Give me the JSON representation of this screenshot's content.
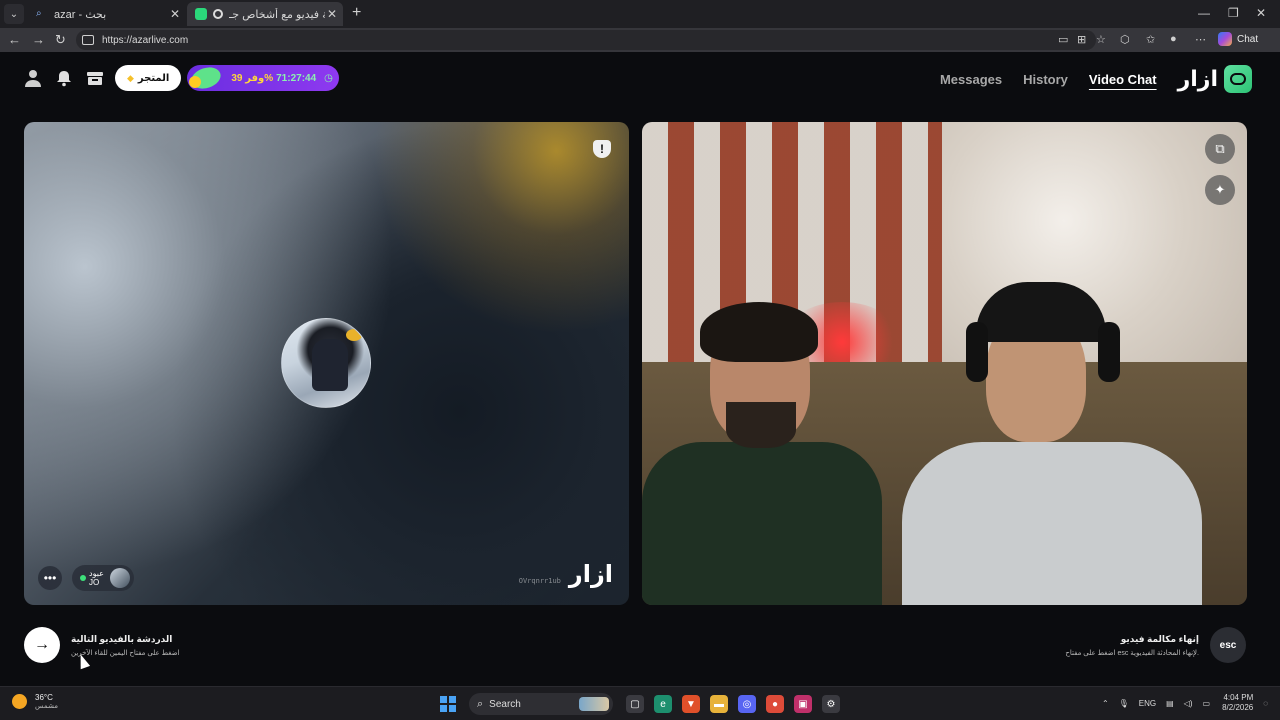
{
  "browser": {
    "tabs": [
      {
        "title": "azar - بحث"
      },
      {
        "title": "أزاردردشة فيديو مع أشخاص جـ"
      }
    ],
    "url": "https://azarlive.com",
    "chat_label": "Chat"
  },
  "header": {
    "store_label": "المتجر",
    "promo_discount": "وفر 39%",
    "promo_timer": "71:27:44",
    "nav": {
      "messages": "Messages",
      "history": "History",
      "video_chat": "Video Chat"
    },
    "brand": "ازار"
  },
  "remote_panel": {
    "peer_name": "عبود",
    "peer_flag": "JO",
    "watermark_code": "OVrqnrr1ub",
    "watermark_logo": "ازار"
  },
  "footer": {
    "next_title": "الدردشة بالفيديو التالية",
    "next_hint": "اضغط على مفتاح اليمين للقاء الآخرين",
    "end_title": "إنهاء مكالمة فيديو",
    "end_hint": "اضغط على مفتاح esc لإنهاء المحادثة الفيديوية.",
    "esc_label": "esc"
  },
  "taskbar": {
    "temperature": "36°C",
    "condition": "مشمس",
    "search_placeholder": "Search",
    "language": "ENG",
    "time": "4:04 PM",
    "date": "8/2/2026"
  },
  "colors": {
    "accent_green": "#2ec476",
    "promo_purple": "#7a34e8",
    "background": "#0b0c0f"
  }
}
